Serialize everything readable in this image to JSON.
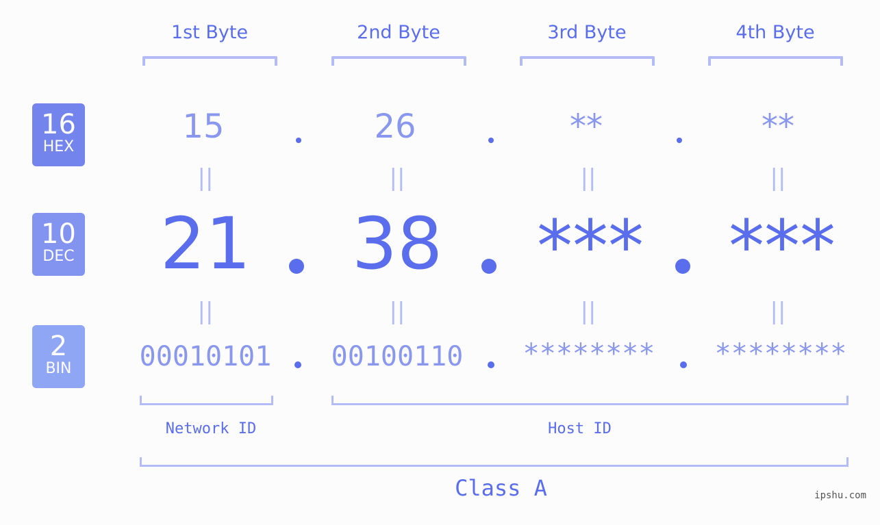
{
  "colors": {
    "primary_text": "#5a6ded",
    "secondary_text": "#8a97ef",
    "bracket": "#b3bcf7",
    "hex_badge": "#7385ec",
    "dec_badge": "#8293f0",
    "bin_badge": "#8fa6f5",
    "background": "#fbfcfb"
  },
  "byte_headers": [
    "1st Byte",
    "2nd Byte",
    "3rd Byte",
    "4th Byte"
  ],
  "badges": {
    "hex": {
      "number": "16",
      "label": "HEX"
    },
    "dec": {
      "number": "10",
      "label": "DEC"
    },
    "bin": {
      "number": "2",
      "label": "BIN"
    }
  },
  "hex_values": [
    "15",
    "26",
    "**",
    "**"
  ],
  "dec_values": [
    "21",
    "38",
    "***",
    "***"
  ],
  "bin_values": [
    "00010101",
    "00100110",
    "********",
    "********"
  ],
  "equals_symbol": "||",
  "segments": {
    "network_id": "Network ID",
    "host_id": "Host ID",
    "class": "Class A"
  },
  "watermark": "ipshu.com"
}
